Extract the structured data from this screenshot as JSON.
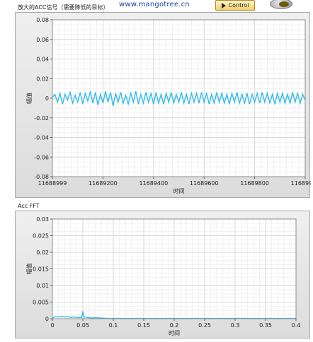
{
  "header": {
    "signal_title": "放大的ACC信号（需要降低的目标）",
    "url": "www.mangotree.cn",
    "control_label": "Control"
  },
  "chart_data": [
    {
      "type": "line",
      "title": "",
      "xlabel": "时间",
      "ylabel": "幅值",
      "xlim": [
        11688999,
        11689999
      ],
      "ylim": [
        -0.08,
        0.08
      ],
      "x_ticks": [
        "11688999",
        "11689200",
        "11689400",
        "11689600",
        "11689800",
        "11689999"
      ],
      "y_ticks": [
        "0.08",
        "0.06",
        "0.04",
        "0.02",
        "0",
        "-0.02",
        "-0.04",
        "-0.06",
        "-0.08"
      ],
      "grid": true,
      "color": "#33bbee",
      "series": [
        {
          "x": [
            11688999,
            11689009,
            11689019,
            11689029,
            11689039,
            11689049,
            11689059,
            11689069,
            11689079,
            11689089,
            11689099,
            11689109,
            11689119,
            11689129,
            11689139,
            11689149,
            11689159,
            11689169,
            11689179,
            11689189,
            11689199,
            11689209,
            11689219,
            11689229,
            11689239,
            11689249,
            11689259,
            11689269,
            11689279,
            11689289,
            11689299,
            11689309,
            11689319,
            11689329,
            11689339,
            11689349,
            11689359,
            11689369,
            11689379,
            11689389,
            11689399,
            11689409,
            11689419,
            11689429,
            11689439,
            11689449,
            11689459,
            11689469,
            11689479,
            11689489,
            11689499,
            11689509,
            11689519,
            11689529,
            11689539,
            11689549,
            11689559,
            11689569,
            11689579,
            11689589,
            11689599,
            11689609,
            11689619,
            11689629,
            11689639,
            11689649,
            11689659,
            11689669,
            11689679,
            11689689,
            11689699,
            11689709,
            11689719,
            11689729,
            11689739,
            11689749,
            11689759,
            11689769,
            11689779,
            11689789,
            11689799,
            11689809,
            11689819,
            11689829,
            11689839,
            11689849,
            11689859,
            11689869,
            11689879,
            11689889,
            11689899,
            11689909,
            11689919,
            11689929,
            11689939,
            11689949,
            11689959,
            11689969,
            11689979,
            11689989,
            11689999
          ],
          "values": [
            0.001,
            0.004,
            -0.004,
            0.005,
            -0.006,
            0.004,
            -0.002,
            0.006,
            -0.005,
            0.003,
            -0.004,
            0.006,
            -0.006,
            0.005,
            -0.003,
            0.007,
            -0.005,
            0.006,
            -0.007,
            0.004,
            -0.005,
            0.007,
            -0.004,
            0.006,
            -0.008,
            0.005,
            -0.004,
            0.006,
            -0.005,
            0.003,
            -0.006,
            0.005,
            -0.004,
            0.007,
            -0.006,
            0.004,
            -0.005,
            0.006,
            -0.004,
            0.005,
            -0.006,
            0.006,
            -0.005,
            0.004,
            -0.006,
            0.005,
            -0.004,
            0.006,
            -0.005,
            0.004,
            -0.004,
            0.006,
            -0.005,
            0.004,
            -0.006,
            0.005,
            -0.004,
            0.005,
            -0.005,
            0.006,
            -0.004,
            0.005,
            -0.006,
            0.004,
            -0.005,
            0.006,
            -0.004,
            0.005,
            -0.005,
            0.004,
            -0.006,
            0.005,
            -0.004,
            0.006,
            -0.005,
            0.004,
            -0.005,
            0.005,
            -0.006,
            0.004,
            -0.004,
            0.005,
            -0.005,
            0.006,
            -0.004,
            0.005,
            -0.005,
            0.004,
            -0.006,
            0.005,
            -0.004,
            0.005,
            -0.005,
            0.004,
            -0.005,
            0.006,
            -0.004,
            0.005,
            -0.005,
            0.004,
            -0.002
          ]
        }
      ]
    },
    {
      "type": "line",
      "title": "Acc FFT",
      "xlabel": "时间",
      "ylabel": "幅值",
      "xlim": [
        0,
        0.4
      ],
      "ylim": [
        0,
        0.03
      ],
      "x_ticks": [
        "0",
        "0.05",
        "0.1",
        "0.15",
        "0.2",
        "0.25",
        "0.3",
        "0.35",
        "0.4"
      ],
      "y_ticks": [
        "0.03",
        "0.025",
        "0.02",
        "0.015",
        "0.01",
        "0.005",
        "0"
      ],
      "grid": true,
      "color": "#33bbee",
      "series": [
        {
          "x": [
            0,
            0.002,
            0.005,
            0.01,
            0.015,
            0.02,
            0.025,
            0.03,
            0.035,
            0.04,
            0.045,
            0.048,
            0.05,
            0.052,
            0.055,
            0.06,
            0.065,
            0.07,
            0.08,
            0.09,
            0.1,
            0.12,
            0.15,
            0.2,
            0.25,
            0.3,
            0.35,
            0.4
          ],
          "values": [
            0.0,
            0.0004,
            0.0006,
            0.0005,
            0.0007,
            0.0005,
            0.0006,
            0.0004,
            0.0005,
            0.0004,
            0.0003,
            0.0004,
            0.0022,
            0.0004,
            0.0005,
            0.0003,
            0.0002,
            0.0003,
            0.0002,
            0.0001,
            0.0001,
            0.0001,
            0.0001,
            0.0001,
            0.0001,
            0.0001,
            0.0001,
            0.0001
          ]
        }
      ]
    }
  ]
}
